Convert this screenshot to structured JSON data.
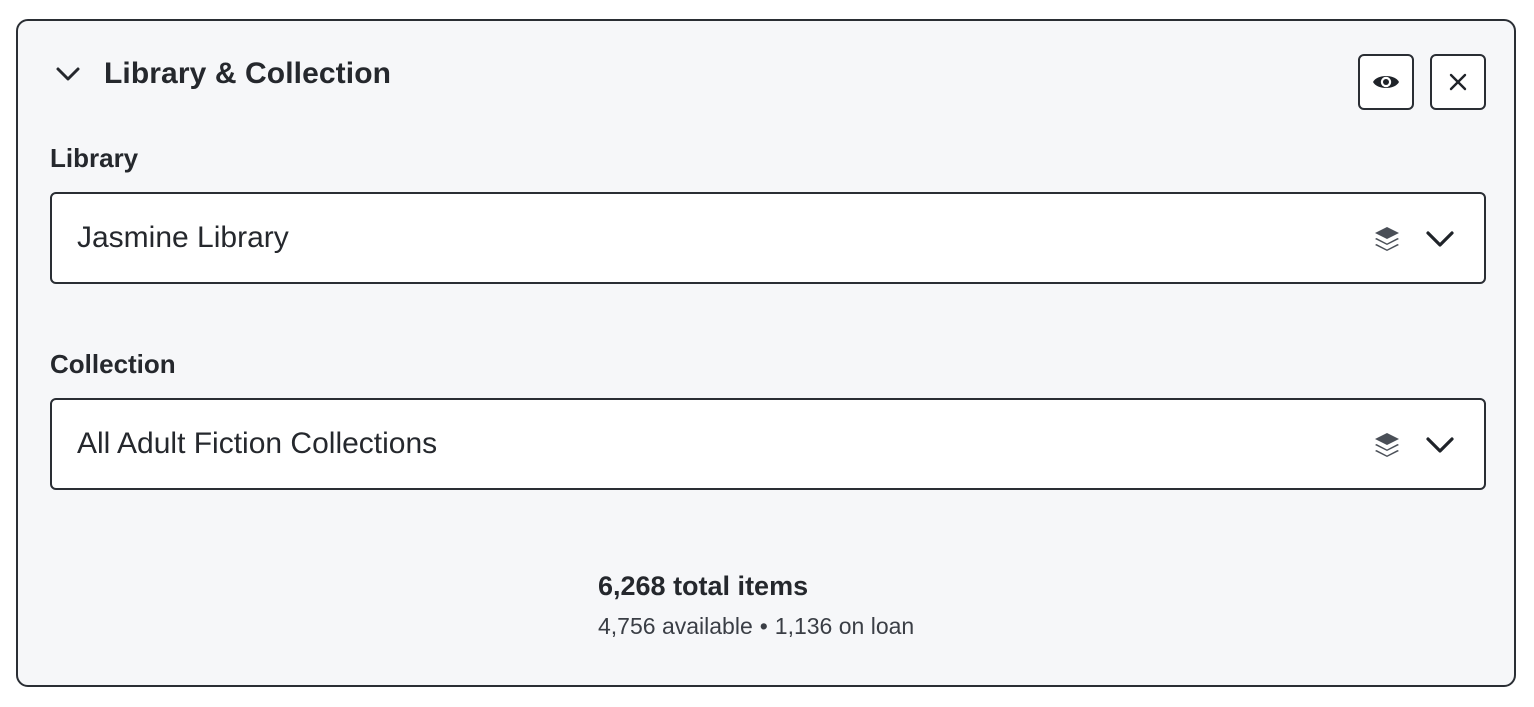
{
  "panel": {
    "title": "Library & Collection",
    "toggle_icon": "chevron-down-icon",
    "actions": {
      "preview_icon": "eye-icon",
      "close_icon": "close-icon"
    }
  },
  "library": {
    "label": "Library",
    "value": "Jasmine Library",
    "icon": "layers-icon"
  },
  "collection": {
    "label": "Collection",
    "value": "All Adult Fiction Collections",
    "icon": "layers-icon"
  },
  "stats": {
    "total": "6,268 total items",
    "available": "4,756 available",
    "separator": "•",
    "on_loan": "1,136 on loan"
  },
  "colors": {
    "border": "#2a2e34",
    "panel_bg": "#f6f7f9",
    "icon": "#4a4f57"
  }
}
